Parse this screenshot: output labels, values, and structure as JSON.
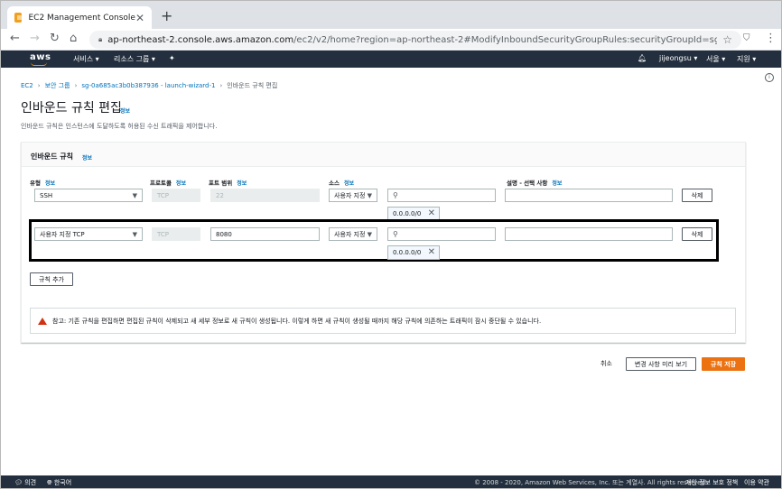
{
  "browser": {
    "tab_title": "EC2 Management Console",
    "url_host": "ap-northeast-2.console.aws.amazon.com",
    "url_path": "/ec2/v2/home?region=ap-northeast-2#ModifyInboundSecurityGroupRules:securityGroupId=sg-0a685ac3..."
  },
  "aws_nav": {
    "logo": "aws",
    "services": "서비스",
    "resource_groups": "리소스 그룹",
    "user": "jijeongsu",
    "region": "서울",
    "support": "지원"
  },
  "breadcrumb": {
    "ec2": "EC2",
    "security_groups": "보안 그룹",
    "sg": "sg-0a685ac3b0b387936 - launch-wizard-1",
    "current": "인바운드 규칙 편집"
  },
  "page": {
    "title": "인바운드 규칙 편집",
    "title_info": "정보",
    "description": "인바운드 규칙은 인스턴스에 도달하도록 허용된 수신 트래픽을 제어합니다."
  },
  "panel": {
    "title": "인바운드 규칙",
    "info": "정보",
    "columns": {
      "type": "유형",
      "protocol": "프로토콜",
      "port_range": "포트 범위",
      "source": "소스",
      "description": "설명 - 선택 사항",
      "info": "정보"
    },
    "rules": [
      {
        "type": "SSH",
        "protocol": "TCP",
        "port": "22",
        "source_type": "사용자 지정",
        "source_search": "",
        "cidr": "0.0.0.0/0",
        "description": "",
        "delete": "삭제"
      },
      {
        "type": "사용자 지정 TCP",
        "protocol": "TCP",
        "port": "8080",
        "source_type": "사용자 지정",
        "source_search": "",
        "cidr": "0.0.0.0/0",
        "description": "",
        "delete": "삭제"
      }
    ],
    "add_rule": "규칙 추가",
    "notice": "참고: 기존 규칙을 편집하면 편집된 규칙이 삭제되고 새 세부 정보로 새 규칙이 생성됩니다. 이렇게 하면 새 규칙이 생성될 때까지 해당 규칙에 의존하는 트래픽이 잠시 중단될 수 있습니다."
  },
  "actions": {
    "cancel": "취소",
    "preview": "변경 사항 미리 보기",
    "save": "규칙 저장"
  },
  "footer": {
    "feedback": "의견",
    "language": "한국어",
    "copyright": "© 2008 - 2020, Amazon Web Services, Inc. 또는 계열사. All rights reserved.",
    "privacy": "개인 정보 보호 정책",
    "terms": "이용 약관"
  }
}
